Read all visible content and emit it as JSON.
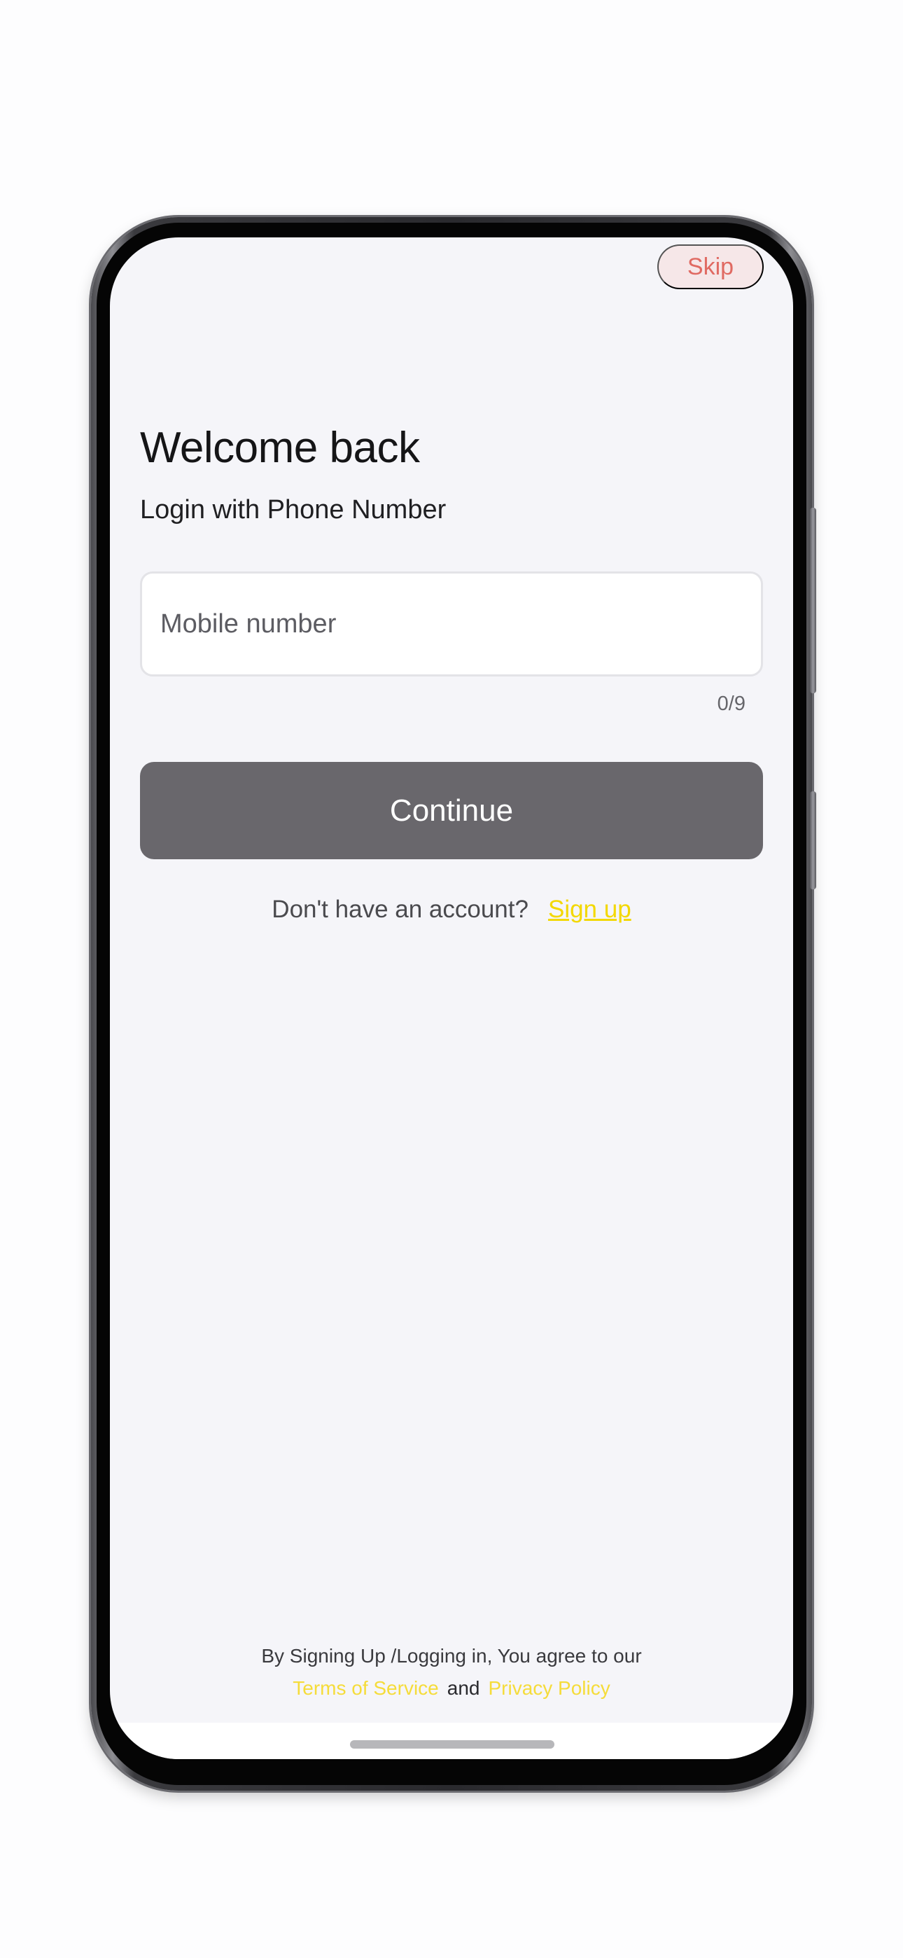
{
  "header": {
    "skip_label": "Skip"
  },
  "login": {
    "title": "Welcome back",
    "subtitle": "Login with Phone Number",
    "mobile_placeholder": "Mobile number",
    "mobile_value": "",
    "char_counter": "0/9",
    "continue_label": "Continue"
  },
  "signup": {
    "prompt": "Don't have an account?",
    "link_label": "Sign up"
  },
  "legal": {
    "agreement_text": "By Signing Up /Logging in, You agree to our",
    "terms_label": "Terms of Service",
    "and_text": "and",
    "privacy_label": "Privacy Policy"
  },
  "colors": {
    "screen_background": "#f5f5f9",
    "skip_background": "#f6e7e8",
    "skip_text": "#e06a62",
    "continue_background": "#69676c",
    "link_accent": "#f3d800"
  }
}
